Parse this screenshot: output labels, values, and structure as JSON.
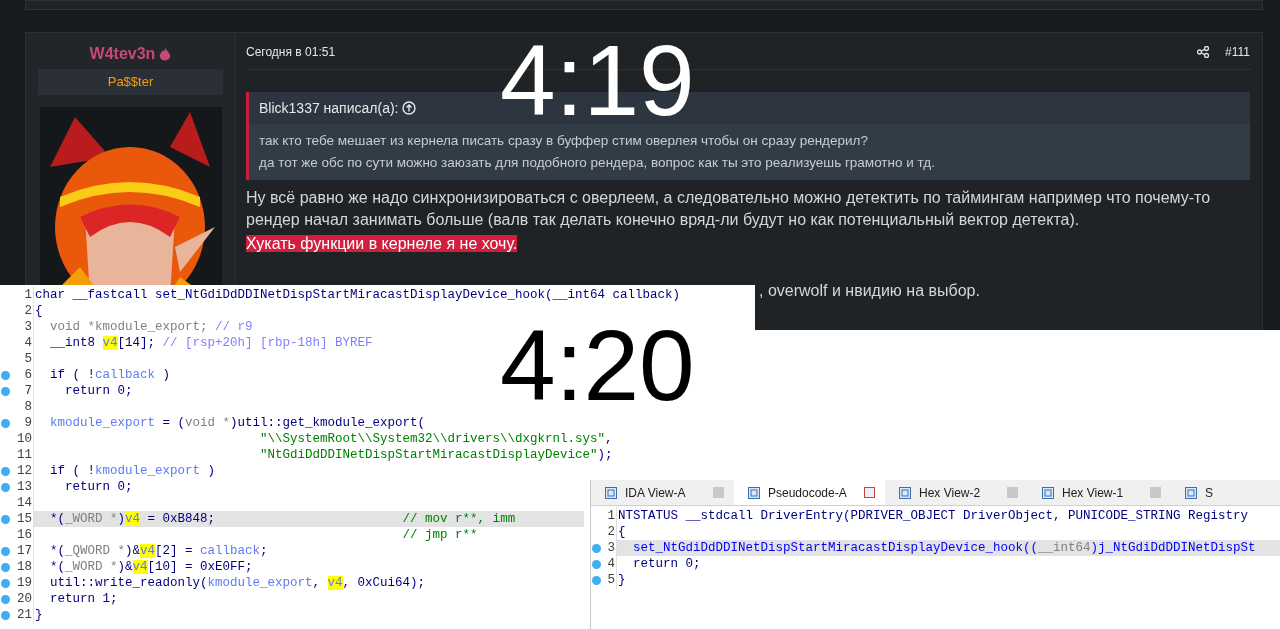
{
  "overlay_times": {
    "top": "4:19",
    "bottom": "4:20"
  },
  "post": {
    "author": "W4tev3n",
    "author_title": "Pa$$ter",
    "date": "Сегодня в 01:51",
    "number": "#111",
    "quote": {
      "header": "Blick1337 написал(а):",
      "lines": [
        "так кто тебе мешает из кернела писать сразу в буффер стим оверлея чтобы он сразу рендерил?",
        "да тот же обс по сути можно заюзать для подобного рендера, вопрос как ты это реализуешь грамотно и тд."
      ]
    },
    "body": "Ну всё равно же надо синхронизироваться с оверлеем, а следовательно можно детектить по таймингам например что почему-то рендер начал занимать больше (валв так делать конечно вряд-ли будут но как потенциальный вектор детекта).",
    "highlighted": "Хукать функции в кернеле я не хочу.",
    "partial_line": ", overwolf и нвидию на выбор."
  },
  "code_left": {
    "lines": [
      {
        "n": "1",
        "breakpoint": false,
        "selected": false,
        "tokens": [
          {
            "kind": "kw",
            "text": "char __fastcall set_NtGdiDdDDINetDispStartMiracastDisplayDevice_hook(__int64 callback)"
          }
        ]
      },
      {
        "n": "2",
        "breakpoint": false,
        "selected": false,
        "tokens": [
          {
            "kind": "kw",
            "text": "{"
          }
        ]
      },
      {
        "n": "3",
        "breakpoint": false,
        "selected": false,
        "tokens": [
          {
            "kind": "gray",
            "text": "  void *kmodule_export; "
          },
          {
            "kind": "cmt",
            "text": "// r9"
          }
        ]
      },
      {
        "n": "4",
        "breakpoint": false,
        "selected": false,
        "tokens": [
          {
            "kind": "kw",
            "text": "  __int8 "
          },
          {
            "kind": "hl",
            "text": "v4"
          },
          {
            "kind": "kw",
            "text": "[14]; "
          },
          {
            "kind": "cmt",
            "text": "// [rsp+20h] [rbp-18h] BYREF"
          }
        ]
      },
      {
        "n": "5",
        "breakpoint": false,
        "selected": false
      },
      {
        "n": "6",
        "breakpoint": true,
        "selected": false,
        "tokens": [
          {
            "kind": "kw",
            "text": "  if ( !"
          },
          {
            "kind": "id",
            "text": "callback"
          },
          {
            "kind": "kw",
            "text": " )"
          }
        ]
      },
      {
        "n": "7",
        "breakpoint": true,
        "selected": false,
        "tokens": [
          {
            "kind": "kw",
            "text": "    return 0;"
          }
        ]
      },
      {
        "n": "8",
        "breakpoint": false,
        "selected": false
      },
      {
        "n": "9",
        "breakpoint": true,
        "selected": false,
        "tokens": [
          {
            "kind": "id",
            "text": "  kmodule_export"
          },
          {
            "kind": "kw",
            "text": " = ("
          },
          {
            "kind": "gray",
            "text": "void *"
          },
          {
            "kind": "kw",
            "text": ")util::get_kmodule_export("
          }
        ]
      },
      {
        "n": "10",
        "breakpoint": false,
        "selected": false,
        "tokens": [
          {
            "kind": "str",
            "text": "                              \"\\\\SystemRoot\\\\System32\\\\drivers\\\\dxgkrnl.sys\""
          },
          {
            "kind": "kw",
            "text": ","
          }
        ]
      },
      {
        "n": "11",
        "breakpoint": false,
        "selected": false,
        "tokens": [
          {
            "kind": "str",
            "text": "                              \"NtGdiDdDDINetDispStartMiracastDisplayDevice\""
          },
          {
            "kind": "kw",
            "text": ");"
          }
        ]
      },
      {
        "n": "12",
        "breakpoint": true,
        "selected": false,
        "tokens": [
          {
            "kind": "kw",
            "text": "  if ( !"
          },
          {
            "kind": "id",
            "text": "kmodule_export"
          },
          {
            "kind": "kw",
            "text": " )"
          }
        ]
      },
      {
        "n": "13",
        "breakpoint": true,
        "selected": false,
        "tokens": [
          {
            "kind": "kw",
            "text": "    return 0;"
          }
        ]
      },
      {
        "n": "14",
        "breakpoint": false,
        "selected": false
      },
      {
        "n": "15",
        "breakpoint": true,
        "selected": true,
        "tokens": [
          {
            "kind": "kw",
            "text": "  *("
          },
          {
            "kind": "gray",
            "text": "_WORD *"
          },
          {
            "kind": "kw",
            "text": ")"
          },
          {
            "kind": "hl",
            "text": "v4"
          },
          {
            "kind": "kw",
            "text": " = 0xB848;                         "
          },
          {
            "kind": "str",
            "text": "// mov r**, imm"
          }
        ]
      },
      {
        "n": "16",
        "breakpoint": false,
        "selected": false,
        "tokens": [
          {
            "kind": "str",
            "text": "                                                 // jmp r**"
          }
        ]
      },
      {
        "n": "17",
        "breakpoint": true,
        "selected": false,
        "tokens": [
          {
            "kind": "kw",
            "text": "  *("
          },
          {
            "kind": "gray",
            "text": "_QWORD *"
          },
          {
            "kind": "kw",
            "text": ")&"
          },
          {
            "kind": "hl",
            "text": "v4"
          },
          {
            "kind": "kw",
            "text": "[2] = "
          },
          {
            "kind": "id",
            "text": "callback"
          },
          {
            "kind": "kw",
            "text": ";"
          }
        ]
      },
      {
        "n": "18",
        "breakpoint": true,
        "selected": false,
        "tokens": [
          {
            "kind": "kw",
            "text": "  *("
          },
          {
            "kind": "gray",
            "text": "_WORD *"
          },
          {
            "kind": "kw",
            "text": ")&"
          },
          {
            "kind": "hl",
            "text": "v4"
          },
          {
            "kind": "kw",
            "text": "[10] = 0xE0FF;"
          }
        ]
      },
      {
        "n": "19",
        "breakpoint": true,
        "selected": false,
        "tokens": [
          {
            "kind": "kw",
            "text": "  util::write_readonly("
          },
          {
            "kind": "id",
            "text": "kmodule_export"
          },
          {
            "kind": "kw",
            "text": ", "
          },
          {
            "kind": "hl",
            "text": "v4"
          },
          {
            "kind": "kw",
            "text": ", 0xCui64);"
          }
        ]
      },
      {
        "n": "20",
        "breakpoint": true,
        "selected": false,
        "tokens": [
          {
            "kind": "kw",
            "text": "  return 1;"
          }
        ]
      },
      {
        "n": "21",
        "breakpoint": true,
        "selected": false,
        "tokens": [
          {
            "kind": "kw",
            "text": "}"
          }
        ]
      }
    ]
  },
  "ida": {
    "tabs": [
      {
        "label": "IDA View-A",
        "selected": false
      },
      {
        "label": "Pseudocode-A",
        "selected": true
      },
      {
        "label": "Hex View-2",
        "selected": false
      },
      {
        "label": "Hex View-1",
        "selected": false
      },
      {
        "label": "S",
        "selected": false
      }
    ],
    "lines": [
      {
        "n": "1",
        "breakpoint": false,
        "selected": false,
        "tokens": [
          {
            "kind": "kw",
            "text": "NTSTATUS __stdcall DriverEntry(PDRIVER_OBJECT DriverObject, PUNICODE_STRING Registry"
          }
        ]
      },
      {
        "n": "2",
        "breakpoint": false,
        "selected": false,
        "tokens": [
          {
            "kind": "kw",
            "text": "{"
          }
        ]
      },
      {
        "n": "3",
        "breakpoint": true,
        "selected": true,
        "tokens": [
          {
            "kind": "fn",
            "text": "  set_NtGdiDdDDINetDispStartMiracastDisplayDevice_hook(("
          },
          {
            "kind": "gray",
            "text": "__int64"
          },
          {
            "kind": "fn",
            "text": ")j_NtGdiDdDDINetDispSt"
          }
        ]
      },
      {
        "n": "4",
        "breakpoint": true,
        "selected": false,
        "tokens": [
          {
            "kind": "kw",
            "text": "  return 0;"
          }
        ]
      },
      {
        "n": "5",
        "breakpoint": true,
        "selected": false,
        "tokens": [
          {
            "kind": "kw",
            "text": "}"
          }
        ]
      }
    ]
  }
}
